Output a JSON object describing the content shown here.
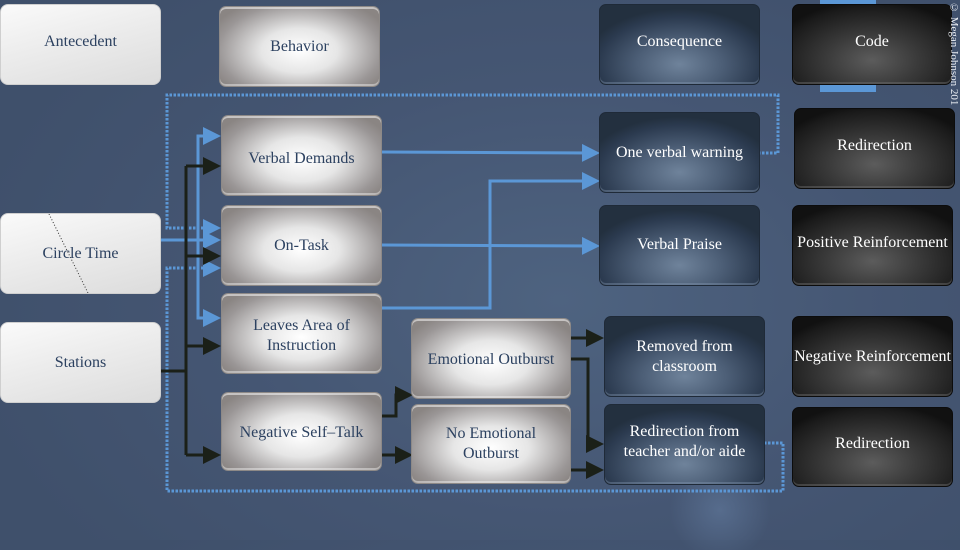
{
  "headers": {
    "antecedent": "Antecedent",
    "behavior": "Behavior",
    "consequence": "Consequence",
    "code": "Code"
  },
  "antecedents": [
    {
      "label": "Circle Time"
    },
    {
      "label": "Stations"
    }
  ],
  "behaviors": [
    {
      "label": "Verbal Demands"
    },
    {
      "label": "On-Task"
    },
    {
      "label": "Leaves Area of Instruction"
    },
    {
      "label": "Negative Self–Talk"
    }
  ],
  "outbursts": [
    {
      "label": "Emotional Outburst"
    },
    {
      "label": "No Emotional Outburst"
    }
  ],
  "consequences": [
    {
      "label": "One verbal warning"
    },
    {
      "label": "Verbal Praise"
    },
    {
      "label": "Removed from classroom"
    },
    {
      "label": "Redirection from teacher and/or aide"
    }
  ],
  "codes": [
    {
      "label": "Redirection"
    },
    {
      "label": "Positive Reinforcement"
    },
    {
      "label": "Negative Reinforcement"
    },
    {
      "label": "Redirection"
    }
  ],
  "copyright": "© Megan Johnson 201",
  "colors": {
    "background": "#455673",
    "blue_connector": "#5b97d6",
    "black_connector": "#1b2018",
    "header_text": "#2c4160"
  }
}
